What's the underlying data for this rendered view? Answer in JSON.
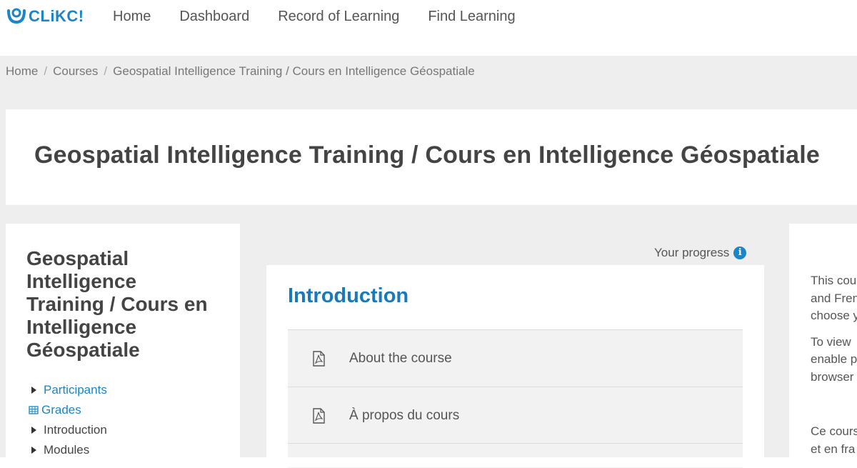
{
  "brand": {
    "logo_text": "CLiKC!",
    "accent": "#1a86c8"
  },
  "nav": {
    "items": [
      "Home",
      "Dashboard",
      "Record of Learning",
      "Find Learning"
    ]
  },
  "breadcrumb": [
    "Home",
    "Courses",
    "Geospatial Intelligence Training / Cours en Intelligence Géospatiale"
  ],
  "page_title": "Geospatial Intelligence Training / Cours en Intelligence Géospatiale",
  "course_block": {
    "title": "Geospatial Intelligence Training / Cours en Intelligence Géospatiale",
    "items": [
      {
        "label": "Participants",
        "icon": "triangle-right-icon",
        "link": true
      },
      {
        "label": "Grades",
        "icon": "grades-table-icon",
        "link": true
      },
      {
        "label": "Introduction",
        "icon": "triangle-right-icon",
        "link": false
      },
      {
        "label": "Modules",
        "icon": "triangle-right-icon",
        "link": false
      }
    ]
  },
  "progress": {
    "label": "Your progress",
    "icon": "info-icon"
  },
  "section": {
    "title": "Introduction",
    "activities": [
      {
        "label": "About the course",
        "icon": "pdf-icon"
      },
      {
        "label": "À propos du cours",
        "icon": "pdf-icon"
      }
    ]
  },
  "right_block": {
    "paragraphs": [
      [
        "This cou",
        "and Fren",
        "choose y"
      ],
      [
        "To view ",
        "enable p",
        "browser"
      ],
      [
        "Ce cours",
        "et en fra"
      ]
    ]
  }
}
